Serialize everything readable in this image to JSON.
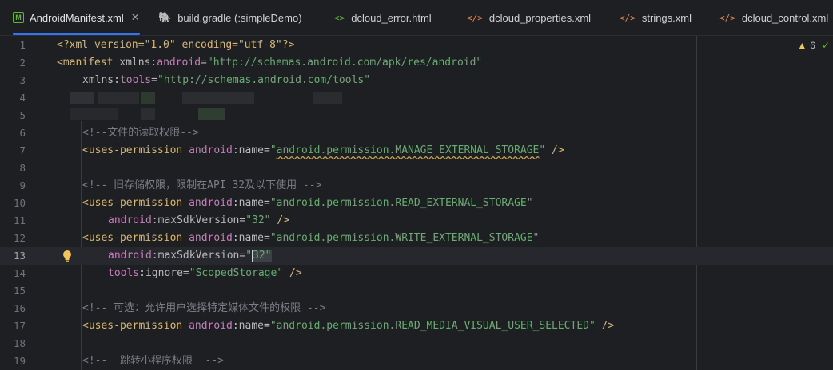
{
  "tabs": [
    {
      "label": "AndroidManifest.xml",
      "icon": "manifest-m-icon",
      "icon_glyph": "M",
      "active": true,
      "closable": true
    },
    {
      "label": "build.gradle (:simpleDemo)",
      "icon": "gradle-elephant-icon",
      "icon_glyph": "🐘",
      "active": false
    },
    {
      "label": "dcloud_error.html",
      "icon": "html-code-icon",
      "icon_glyph": "<>",
      "active": false
    },
    {
      "label": "dcloud_properties.xml",
      "icon": "xml-code-icon",
      "icon_glyph": "</>",
      "active": false
    },
    {
      "label": "strings.xml",
      "icon": "xml-code-icon",
      "icon_glyph": "</>",
      "active": false
    },
    {
      "label": "dcloud_control.xml",
      "icon": "xml-code-icon",
      "icon_glyph": "</>",
      "active": false
    }
  ],
  "inspection": {
    "warnings": "6",
    "ok_glyph": "✓"
  },
  "colors": {
    "background": "#1e1f22",
    "tag": "#d5b778",
    "attr": "#bababa",
    "namespace": "#c77dbb",
    "string": "#6aab73",
    "comment": "#7a7e85",
    "accent": "#3574f0"
  },
  "lines": {
    "n1": "1",
    "n2": "2",
    "n3": "3",
    "n4": "4",
    "n5": "5",
    "n6": "6",
    "n7": "7",
    "n8": "8",
    "n9": "9",
    "n10": "10",
    "n11": "11",
    "n12": "12",
    "n13": "13",
    "n14": "14",
    "n15": "15",
    "n16": "16",
    "n17": "17",
    "n18": "18",
    "n19": "19"
  },
  "code": {
    "l1": "<?xml version=\"1.0\" encoding=\"utf-8\"?>",
    "l2_tag": "<manifest ",
    "l2_attr": "xmlns:",
    "l2_ns": "android",
    "l2_eq": "=",
    "l2_val": "\"http://schemas.android.com/apk/res/android\"",
    "l3_attr": "xmlns:",
    "l3_ns": "tools",
    "l3_eq": "=",
    "l3_val": "\"http://schemas.android.com/tools\"",
    "l6": "<!--文件的读取权限-->",
    "l7_tag": "<uses-permission ",
    "l7_ns": "android",
    "l7_attr": ":name=",
    "l7_q1": "\"",
    "l7_val": "android.permission.MANAGE_EXTERNAL_STORAGE",
    "l7_q2": "\"",
    "l7_end": " />",
    "l9": "<!-- 旧存储权限，限制在API 32及以下使用 -->",
    "l10_tag": "<uses-permission ",
    "l10_ns": "android",
    "l10_attr": ":name=",
    "l10_val": "\"android.permission.READ_EXTERNAL_STORAGE\"",
    "l11_ns": "android",
    "l11_attr": ":maxSdkVersion=",
    "l11_val": "\"32\"",
    "l11_end": " />",
    "l12_tag": "<uses-permission ",
    "l12_ns": "android",
    "l12_attr": ":name=",
    "l12_val": "\"android.permission.WRITE_EXTERNAL_STORAGE\"",
    "l13_ns": "android",
    "l13_attr": ":maxSdkVersion=",
    "l13_val_a": "\"",
    "l13_val_b": "32\"",
    "l14_ns": "tools",
    "l14_attr": ":ignore=",
    "l14_val": "\"ScopedStorage\"",
    "l14_end": " />",
    "l16": "<!-- 可选：允许用户选择特定媒体文件的权限 -->",
    "l17_tag": "<uses-permission ",
    "l17_ns": "android",
    "l17_attr": ":name=",
    "l17_val": "\"android.permission.READ_MEDIA_VISUAL_USER_SELECTED\"",
    "l17_end": " />",
    "l19": "<!--  跳转小程序权限  -->"
  }
}
